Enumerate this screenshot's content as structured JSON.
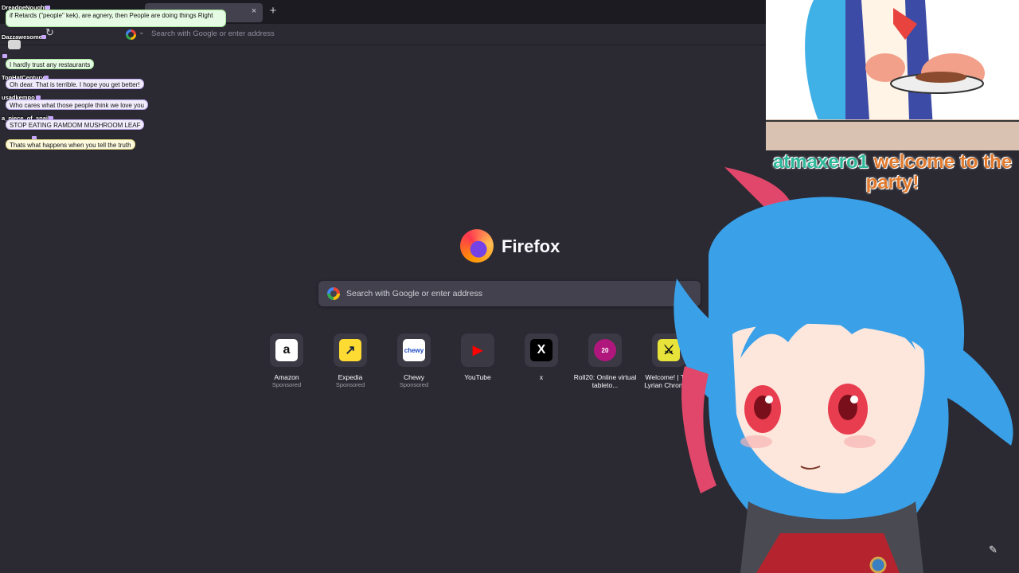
{
  "browser": {
    "url_placeholder": "Search with Google or enter address",
    "tab_close_icon": "×",
    "new_tab_icon": "+",
    "reload_icon": "↻"
  },
  "chat": [
    {
      "user": "DreadgeNought",
      "message": "if Retards (\"people\" kek), are agnery, then People are doing things Right",
      "color": "green"
    },
    {
      "user": "Dazzawesome",
      "message": "",
      "color": "purple"
    },
    {
      "user": "",
      "message": "I hardly trust any restaurants",
      "color": "green"
    },
    {
      "user": "TopHatCentury",
      "message": "Oh dear. That is terrible. I hope you get better!",
      "color": "purple"
    },
    {
      "user": "usadkempo",
      "message": "Who cares what those people think we love you",
      "color": "purple"
    },
    {
      "user": "a_piece_of_snail",
      "message": "STOP EATING RAMDOM MUSHROOM LEAF",
      "color": "purple"
    },
    {
      "user": "",
      "message": "Thats what happens when you tell the truth",
      "color": "yellow"
    }
  ],
  "newtab": {
    "brand": "Firefox",
    "search_placeholder": "Search with Google or enter address",
    "sites": [
      {
        "name": "Amazon",
        "sub": "Sponsored",
        "icon": "amazon-icon",
        "glyph": "a",
        "bg": "#ffffff",
        "fg": "#111111"
      },
      {
        "name": "Expedia",
        "sub": "Sponsored",
        "icon": "expedia-icon",
        "glyph": "↗",
        "bg": "#fddb32",
        "fg": "#1e243a"
      },
      {
        "name": "Chewy",
        "sub": "Sponsored",
        "icon": "chewy-icon",
        "glyph": "chewy",
        "bg": "#ffffff",
        "fg": "#1c49c2"
      },
      {
        "name": "YouTube",
        "sub": "",
        "icon": "youtube-icon",
        "glyph": "▶",
        "bg": "#3a3944",
        "fg": "#ff0000"
      },
      {
        "name": "x",
        "sub": "",
        "icon": "x-icon",
        "glyph": "X",
        "bg": "#000000",
        "fg": "#ffffff"
      },
      {
        "name": "Roll20: Online virtual tableto...",
        "sub": "",
        "icon": "roll20-icon",
        "glyph": "20",
        "bg": "#3a3944",
        "fg": "#ffffff"
      },
      {
        "name": "Welcome! | The Lyrian Chronic...",
        "sub": "",
        "icon": "lyrian-icon",
        "glyph": "⚔",
        "bg": "#e7e33a",
        "fg": "#111111"
      }
    ]
  },
  "overlay": {
    "welcome_name": "atmaxero1",
    "welcome_text": "welcome to the party!",
    "edit_icon": "✎"
  }
}
